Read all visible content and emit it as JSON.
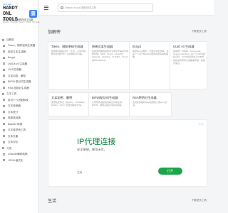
{
  "logo": {
    "small": "ONLINE",
    "title": "HANDY ONL TOOLS",
    "badge": "查",
    "sub": "好用 - 便利方便的在线工具箱",
    "sub2": "HANDY ONLINE TOOLS - BEST ONLINE"
  },
  "nav": {
    "items": [
      {
        "label": "加解密",
        "group": true
      },
      {
        "label": "Token、随机密码生成器",
        "group": false
      },
      {
        "label": "哈希文本生成器",
        "group": false
      },
      {
        "label": "Bcrypt",
        "group": false
      },
      {
        "label": "UUIDs v4 生成器",
        "group": false
      },
      {
        "label": "ULID生成器",
        "group": false
      },
      {
        "label": "文本加密、解密",
        "group": false
      },
      {
        "label": "BIP39 助记词生成器",
        "group": false
      },
      {
        "label": "RSA 密钥对生成器",
        "group": false
      },
      {
        "label": "文本工具",
        "group": true
      },
      {
        "label": "英汉十六进制转换",
        "group": false
      },
      {
        "label": "文本转换器",
        "group": false
      },
      {
        "label": "文本统计",
        "group": false
      },
      {
        "label": "简繁体转换",
        "group": false
      },
      {
        "label": "Base64 转换",
        "group": false
      },
      {
        "label": "汉字转拼音工具",
        "group": false
      },
      {
        "label": "文本去重",
        "group": false
      },
      {
        "label": "文本对比",
        "group": false
      },
      {
        "label": "开发",
        "group": true
      },
      {
        "label": "Unicode编码转换",
        "group": false
      },
      {
        "label": "JSON 格式化",
        "group": false
      }
    ]
  },
  "search": {
    "placeholder": "Search a tool 搜索在线工具"
  },
  "sections": {
    "crypto": {
      "title": "加解密",
      "more": "下载更多工具"
    },
    "life": {
      "title": "生活",
      "more": "下载更多工具"
    }
  },
  "cards": [
    {
      "title": "Token、随机密码生成器",
      "desc": "使用你选择的字符（大写、小写字母、数字和/或符号）生成随机字符串。"
    },
    {
      "title": "哈希文本生成器",
      "desc": "使用你所需的函数对文本字符串进行哈希处理：MD5、SHA1、SHA256、SHA224、SHA512、SHA384、SHA3或RIPEMD160"
    },
    {
      "title": "Bcrypt",
      "desc": "使用Bcrypt散列、比较文本字符串，这是一个基于Blowfish密码的密码哈希函数。"
    },
    {
      "title": "UUID v4 生成器",
      "desc": "通用唯一识别码（Universally Unique Identifier）是一个128位的标识符。UUID的目的是让分布式系统中的所有元素都能有唯一的辨识信息。"
    },
    {
      "title": "文本加密、解密",
      "desc": "使用加密算法（如AES、TripleDES、Rabbit、RC4）加密和解密文本。"
    },
    {
      "title": "BIP39助记词生成器",
      "desc": "从现有的或随机的助记词中生成 BIP39，或者从助记词中获取熵。"
    },
    {
      "title": "RSA密钥对生成器",
      "desc": "生成新的随机RSA私钥和公钥pem证书。"
    }
  ],
  "ad": {
    "title": "IP代理连接",
    "subtitle": "安全便捷，使用无忧。",
    "brand": "芝麻",
    "button": "打开",
    "close": "×",
    "info": "ⓘ ×"
  }
}
